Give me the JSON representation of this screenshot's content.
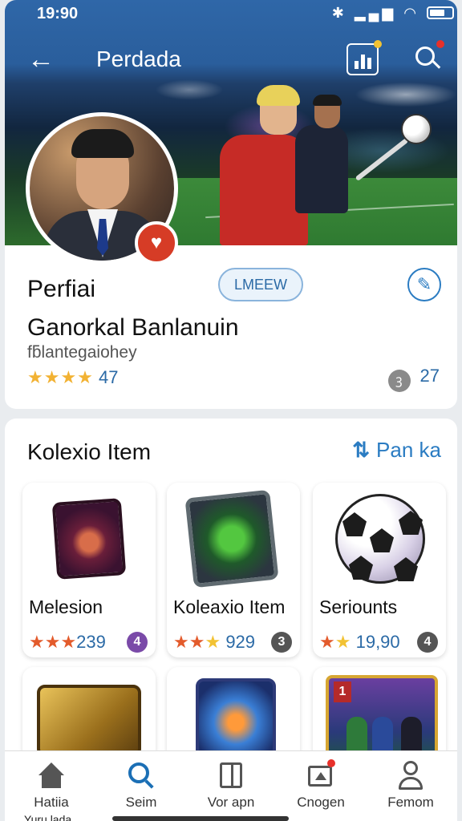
{
  "status_bar": {
    "time": "19:90",
    "icons": "✱ ▂▄▆ ◠"
  },
  "header": {
    "title": "Perdada",
    "back": "←"
  },
  "profile": {
    "label": "Perfiai",
    "chip": "LMEEW",
    "name": "Ganorkal Banlanuin",
    "handle": "fƃlantegaiohey",
    "stars": "★★★★",
    "rating": "47",
    "count": "27",
    "location_icon": "ꝫ"
  },
  "collection": {
    "title": "Kolexio Item",
    "link_label": "Pan ka",
    "items": [
      {
        "name": "Melesion",
        "stars_a": "★★★",
        "stars_b": "",
        "value": "239",
        "badge": "4",
        "badge_color": "#7a4aa8"
      },
      {
        "name": "Koleaxio Item",
        "stars_a": "★★",
        "stars_b": "★",
        "value": "929",
        "badge": "3",
        "badge_color": "#555555"
      },
      {
        "name": "Seriounts",
        "stars_a": "★",
        "stars_b": "★",
        "value": "19,90",
        "badge": "4",
        "badge_color": "#555555"
      }
    ],
    "tcard_number": "1"
  },
  "bottom_nav": [
    {
      "label": "Hatiia",
      "icon": "home-icon"
    },
    {
      "label": "Seim",
      "icon": "search-icon"
    },
    {
      "label": "Vor apn",
      "icon": "book-icon"
    },
    {
      "label": "Cnogen",
      "icon": "message-icon"
    },
    {
      "label": "Femom",
      "icon": "person-icon"
    }
  ],
  "footer_cut": "Yuru lada",
  "colors": {
    "accent": "#2b7cc2",
    "hero_top": "#2f67a8",
    "badge_red": "#d63c26",
    "star": "#f2b233"
  }
}
